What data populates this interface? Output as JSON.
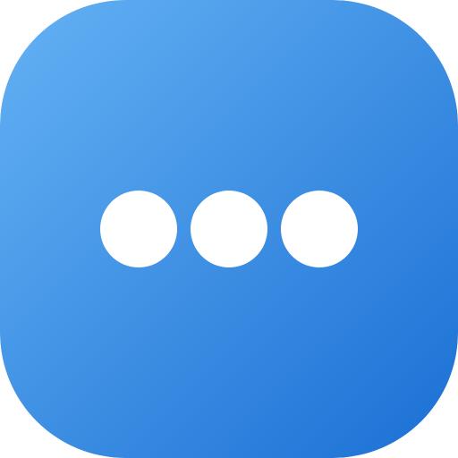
{
  "icon": {
    "name": "more-options-icon",
    "colors": {
      "gradient_start": "#64B2F4",
      "gradient_end": "#1A6FD4",
      "dot": "#FFFFFF"
    },
    "dot_count": 3
  }
}
